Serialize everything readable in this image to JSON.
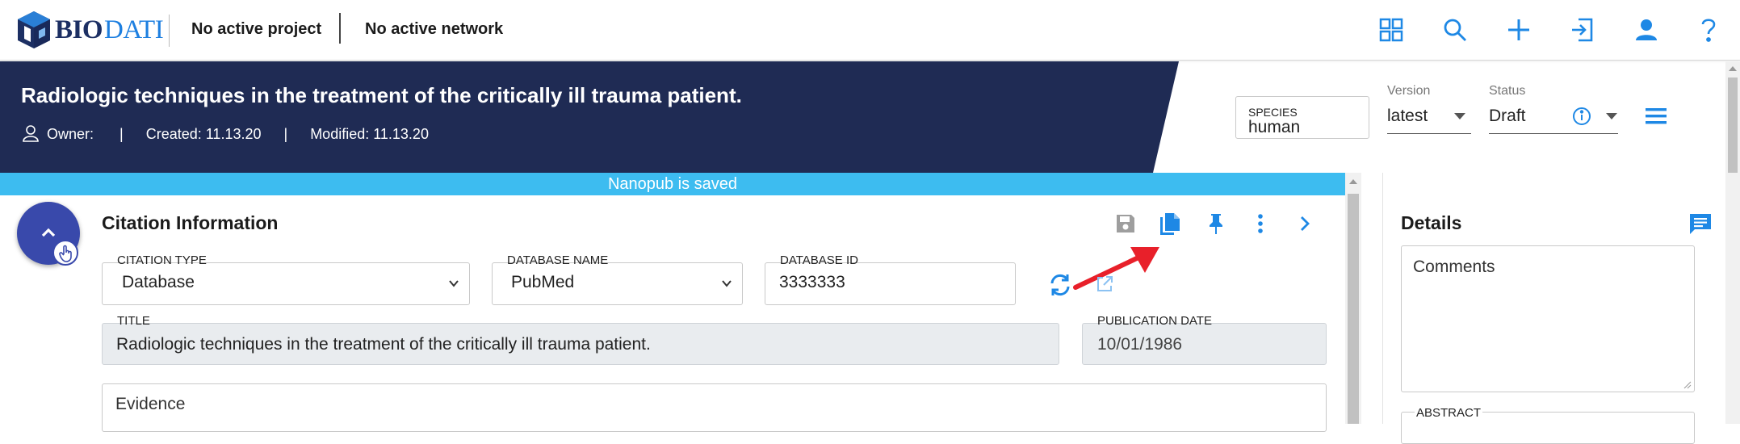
{
  "nav": {
    "logo_bold": "BIO",
    "logo_light": "DATI",
    "project": "No active project",
    "network": "No active network",
    "icons": [
      "grid-icon",
      "search-icon",
      "plus-icon",
      "login-icon",
      "user-icon",
      "help-icon"
    ]
  },
  "header": {
    "title": "Radiologic techniques in the treatment of the critically ill trauma patient.",
    "owner_label": "Owner:",
    "separator": "|",
    "created": "Created: 11.13.20",
    "modified": "Modified: 11.13.20",
    "species_label": "SPECIES",
    "species_value": "human",
    "version_label": "Version",
    "version_value": "latest",
    "status_label": "Status",
    "status_value": "Draft"
  },
  "banner": {
    "text": "Nanopub is saved"
  },
  "citation": {
    "section_title": "Citation Information",
    "citation_type_label": "CITATION TYPE",
    "citation_type_value": "Database",
    "database_name_label": "DATABASE NAME",
    "database_name_value": "PubMed",
    "database_id_label": "DATABASE ID",
    "database_id_value": "3333333",
    "title_label": "TITLE",
    "title_value": "Radiologic techniques in the treatment of the critically ill trauma patient.",
    "pub_date_label": "PUBLICATION DATE",
    "pub_date_value": "10/01/1986",
    "evidence_placeholder": "Evidence"
  },
  "details": {
    "title": "Details",
    "comments_placeholder": "Comments",
    "abstract_label": "ABSTRACT"
  },
  "colors": {
    "header_bg": "#1f2b54",
    "banner_bg": "#3dbcf0",
    "accent_blue": "#1e88e5",
    "fab_bg": "#3949ab",
    "annotation_arrow": "#e8202a"
  }
}
